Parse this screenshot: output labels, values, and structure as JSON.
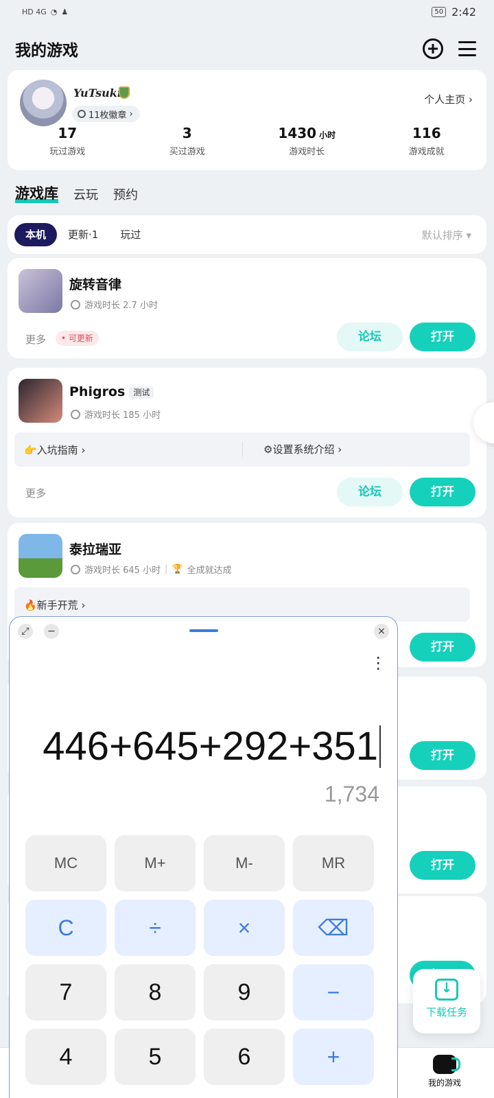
{
  "status": {
    "left": "HD 4G",
    "time": "2:42",
    "battery": "50"
  },
  "header": {
    "title": "我的游戏"
  },
  "profile": {
    "username": "YuTsuki",
    "medals": "11枚徽章",
    "homepage": "个人主页",
    "stats": [
      {
        "value": "17",
        "unit": "",
        "label": "玩过游戏"
      },
      {
        "value": "3",
        "unit": "",
        "label": "买过游戏"
      },
      {
        "value": "1430",
        "unit": "小时",
        "label": "游戏时长"
      },
      {
        "value": "116",
        "unit": "",
        "label": "游戏成就"
      }
    ]
  },
  "library_tabs": [
    "游戏库",
    "云玩",
    "预约"
  ],
  "filters": {
    "chips": [
      "本机",
      "更新·1",
      "玩过"
    ],
    "sort": "默认排序 ▾"
  },
  "games": [
    {
      "name": "旋转音律",
      "time": "游戏时长 2.7 小时",
      "more": "更多",
      "tag": "• 可更新",
      "forum": "论坛",
      "open": "打开"
    },
    {
      "name": "Phigros",
      "test": "测试",
      "time": "游戏时长 185 小时",
      "guide_left": "👉入坑指南 ›",
      "guide_right": "⚙设置系统介绍 ›",
      "more": "更多",
      "forum": "论坛",
      "open": "打开"
    },
    {
      "name": "泰拉瑞亚",
      "time": "游戏时长 645 小时",
      "achievement": "全成就达成",
      "guide_left": "🔥新手开荒 ›",
      "open": "打开"
    }
  ],
  "extra_open": [
    "打开",
    "打开",
    "打开"
  ],
  "download": {
    "label": "下载任务"
  },
  "bottom_nav": {
    "my_games": "我的游戏"
  },
  "calculator": {
    "expression": "446+645+292+351",
    "result": "1,734",
    "keys": [
      [
        "MC",
        "M+",
        "M-",
        "MR"
      ],
      [
        "C",
        "÷",
        "×",
        "⌫"
      ],
      [
        "7",
        "8",
        "9",
        "−"
      ],
      [
        "4",
        "5",
        "6",
        "+"
      ]
    ]
  }
}
